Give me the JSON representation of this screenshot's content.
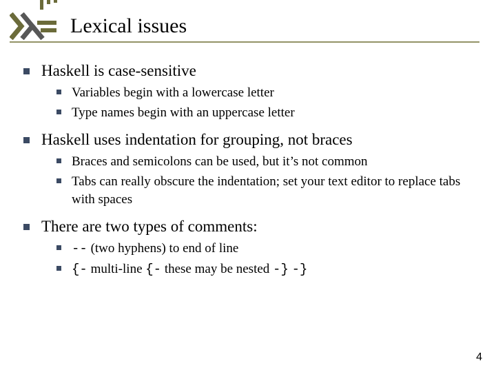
{
  "title": "Lexical issues",
  "bullets": {
    "b1": {
      "text": "Haskell is case-sensitive",
      "sub": {
        "s1": "Variables begin with a lowercase letter",
        "s2": "Type names begin with an uppercase letter"
      }
    },
    "b2": {
      "text": "Haskell uses indentation for grouping, not braces",
      "sub": {
        "s1": "Braces and semicolons can be used, but it’s not common",
        "s2": "Tabs can really obscure the indentation; set your text editor to replace tabs with spaces"
      }
    },
    "b3": {
      "text": "There are two types of comments:",
      "sub": {
        "s1_code": " --",
        "s1_rest": " (two hyphens) to end of line",
        "s2_a": "{-",
        "s2_b": " multi-line ",
        "s2_c": "{-",
        "s2_d": " these may be nested ",
        "s2_e": "-}",
        "s2_f": " ",
        "s2_g": "-}"
      }
    }
  },
  "page_number": "4"
}
